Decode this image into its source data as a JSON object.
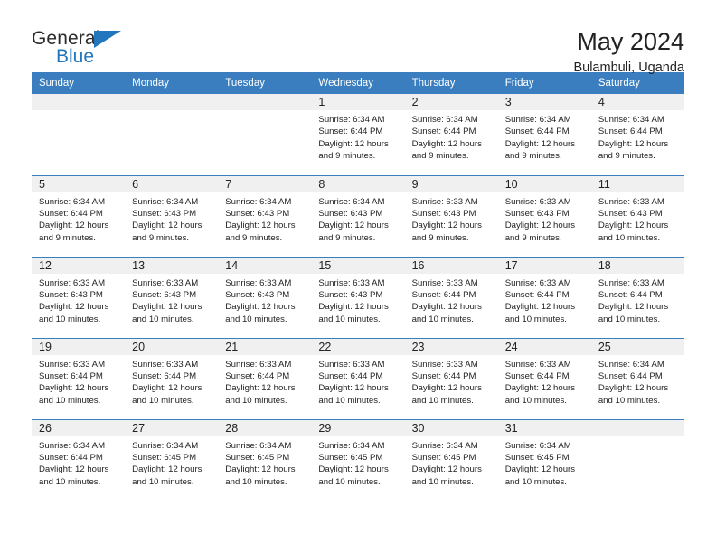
{
  "brand": {
    "name_top": "General",
    "name_bottom": "Blue",
    "accent_color": "#2176bd"
  },
  "header": {
    "title": "May 2024",
    "subtitle": "Bulambuli, Uganda"
  },
  "calendar": {
    "header_bg": "#3a7ebf",
    "weekday_headers": [
      "Sunday",
      "Monday",
      "Tuesday",
      "Wednesday",
      "Thursday",
      "Friday",
      "Saturday"
    ],
    "weeks": [
      [
        {
          "day": "",
          "sunrise": "",
          "sunset": "",
          "daylight_line1": "",
          "daylight_line2": ""
        },
        {
          "day": "",
          "sunrise": "",
          "sunset": "",
          "daylight_line1": "",
          "daylight_line2": ""
        },
        {
          "day": "",
          "sunrise": "",
          "sunset": "",
          "daylight_line1": "",
          "daylight_line2": ""
        },
        {
          "day": "1",
          "sunrise": "Sunrise: 6:34 AM",
          "sunset": "Sunset: 6:44 PM",
          "daylight_line1": "Daylight: 12 hours",
          "daylight_line2": "and 9 minutes."
        },
        {
          "day": "2",
          "sunrise": "Sunrise: 6:34 AM",
          "sunset": "Sunset: 6:44 PM",
          "daylight_line1": "Daylight: 12 hours",
          "daylight_line2": "and 9 minutes."
        },
        {
          "day": "3",
          "sunrise": "Sunrise: 6:34 AM",
          "sunset": "Sunset: 6:44 PM",
          "daylight_line1": "Daylight: 12 hours",
          "daylight_line2": "and 9 minutes."
        },
        {
          "day": "4",
          "sunrise": "Sunrise: 6:34 AM",
          "sunset": "Sunset: 6:44 PM",
          "daylight_line1": "Daylight: 12 hours",
          "daylight_line2": "and 9 minutes."
        }
      ],
      [
        {
          "day": "5",
          "sunrise": "Sunrise: 6:34 AM",
          "sunset": "Sunset: 6:44 PM",
          "daylight_line1": "Daylight: 12 hours",
          "daylight_line2": "and 9 minutes."
        },
        {
          "day": "6",
          "sunrise": "Sunrise: 6:34 AM",
          "sunset": "Sunset: 6:43 PM",
          "daylight_line1": "Daylight: 12 hours",
          "daylight_line2": "and 9 minutes."
        },
        {
          "day": "7",
          "sunrise": "Sunrise: 6:34 AM",
          "sunset": "Sunset: 6:43 PM",
          "daylight_line1": "Daylight: 12 hours",
          "daylight_line2": "and 9 minutes."
        },
        {
          "day": "8",
          "sunrise": "Sunrise: 6:34 AM",
          "sunset": "Sunset: 6:43 PM",
          "daylight_line1": "Daylight: 12 hours",
          "daylight_line2": "and 9 minutes."
        },
        {
          "day": "9",
          "sunrise": "Sunrise: 6:33 AM",
          "sunset": "Sunset: 6:43 PM",
          "daylight_line1": "Daylight: 12 hours",
          "daylight_line2": "and 9 minutes."
        },
        {
          "day": "10",
          "sunrise": "Sunrise: 6:33 AM",
          "sunset": "Sunset: 6:43 PM",
          "daylight_line1": "Daylight: 12 hours",
          "daylight_line2": "and 9 minutes."
        },
        {
          "day": "11",
          "sunrise": "Sunrise: 6:33 AM",
          "sunset": "Sunset: 6:43 PM",
          "daylight_line1": "Daylight: 12 hours",
          "daylight_line2": "and 10 minutes."
        }
      ],
      [
        {
          "day": "12",
          "sunrise": "Sunrise: 6:33 AM",
          "sunset": "Sunset: 6:43 PM",
          "daylight_line1": "Daylight: 12 hours",
          "daylight_line2": "and 10 minutes."
        },
        {
          "day": "13",
          "sunrise": "Sunrise: 6:33 AM",
          "sunset": "Sunset: 6:43 PM",
          "daylight_line1": "Daylight: 12 hours",
          "daylight_line2": "and 10 minutes."
        },
        {
          "day": "14",
          "sunrise": "Sunrise: 6:33 AM",
          "sunset": "Sunset: 6:43 PM",
          "daylight_line1": "Daylight: 12 hours",
          "daylight_line2": "and 10 minutes."
        },
        {
          "day": "15",
          "sunrise": "Sunrise: 6:33 AM",
          "sunset": "Sunset: 6:43 PM",
          "daylight_line1": "Daylight: 12 hours",
          "daylight_line2": "and 10 minutes."
        },
        {
          "day": "16",
          "sunrise": "Sunrise: 6:33 AM",
          "sunset": "Sunset: 6:44 PM",
          "daylight_line1": "Daylight: 12 hours",
          "daylight_line2": "and 10 minutes."
        },
        {
          "day": "17",
          "sunrise": "Sunrise: 6:33 AM",
          "sunset": "Sunset: 6:44 PM",
          "daylight_line1": "Daylight: 12 hours",
          "daylight_line2": "and 10 minutes."
        },
        {
          "day": "18",
          "sunrise": "Sunrise: 6:33 AM",
          "sunset": "Sunset: 6:44 PM",
          "daylight_line1": "Daylight: 12 hours",
          "daylight_line2": "and 10 minutes."
        }
      ],
      [
        {
          "day": "19",
          "sunrise": "Sunrise: 6:33 AM",
          "sunset": "Sunset: 6:44 PM",
          "daylight_line1": "Daylight: 12 hours",
          "daylight_line2": "and 10 minutes."
        },
        {
          "day": "20",
          "sunrise": "Sunrise: 6:33 AM",
          "sunset": "Sunset: 6:44 PM",
          "daylight_line1": "Daylight: 12 hours",
          "daylight_line2": "and 10 minutes."
        },
        {
          "day": "21",
          "sunrise": "Sunrise: 6:33 AM",
          "sunset": "Sunset: 6:44 PM",
          "daylight_line1": "Daylight: 12 hours",
          "daylight_line2": "and 10 minutes."
        },
        {
          "day": "22",
          "sunrise": "Sunrise: 6:33 AM",
          "sunset": "Sunset: 6:44 PM",
          "daylight_line1": "Daylight: 12 hours",
          "daylight_line2": "and 10 minutes."
        },
        {
          "day": "23",
          "sunrise": "Sunrise: 6:33 AM",
          "sunset": "Sunset: 6:44 PM",
          "daylight_line1": "Daylight: 12 hours",
          "daylight_line2": "and 10 minutes."
        },
        {
          "day": "24",
          "sunrise": "Sunrise: 6:33 AM",
          "sunset": "Sunset: 6:44 PM",
          "daylight_line1": "Daylight: 12 hours",
          "daylight_line2": "and 10 minutes."
        },
        {
          "day": "25",
          "sunrise": "Sunrise: 6:34 AM",
          "sunset": "Sunset: 6:44 PM",
          "daylight_line1": "Daylight: 12 hours",
          "daylight_line2": "and 10 minutes."
        }
      ],
      [
        {
          "day": "26",
          "sunrise": "Sunrise: 6:34 AM",
          "sunset": "Sunset: 6:44 PM",
          "daylight_line1": "Daylight: 12 hours",
          "daylight_line2": "and 10 minutes."
        },
        {
          "day": "27",
          "sunrise": "Sunrise: 6:34 AM",
          "sunset": "Sunset: 6:45 PM",
          "daylight_line1": "Daylight: 12 hours",
          "daylight_line2": "and 10 minutes."
        },
        {
          "day": "28",
          "sunrise": "Sunrise: 6:34 AM",
          "sunset": "Sunset: 6:45 PM",
          "daylight_line1": "Daylight: 12 hours",
          "daylight_line2": "and 10 minutes."
        },
        {
          "day": "29",
          "sunrise": "Sunrise: 6:34 AM",
          "sunset": "Sunset: 6:45 PM",
          "daylight_line1": "Daylight: 12 hours",
          "daylight_line2": "and 10 minutes."
        },
        {
          "day": "30",
          "sunrise": "Sunrise: 6:34 AM",
          "sunset": "Sunset: 6:45 PM",
          "daylight_line1": "Daylight: 12 hours",
          "daylight_line2": "and 10 minutes."
        },
        {
          "day": "31",
          "sunrise": "Sunrise: 6:34 AM",
          "sunset": "Sunset: 6:45 PM",
          "daylight_line1": "Daylight: 12 hours",
          "daylight_line2": "and 10 minutes."
        },
        {
          "day": "",
          "sunrise": "",
          "sunset": "",
          "daylight_line1": "",
          "daylight_line2": ""
        }
      ]
    ]
  }
}
